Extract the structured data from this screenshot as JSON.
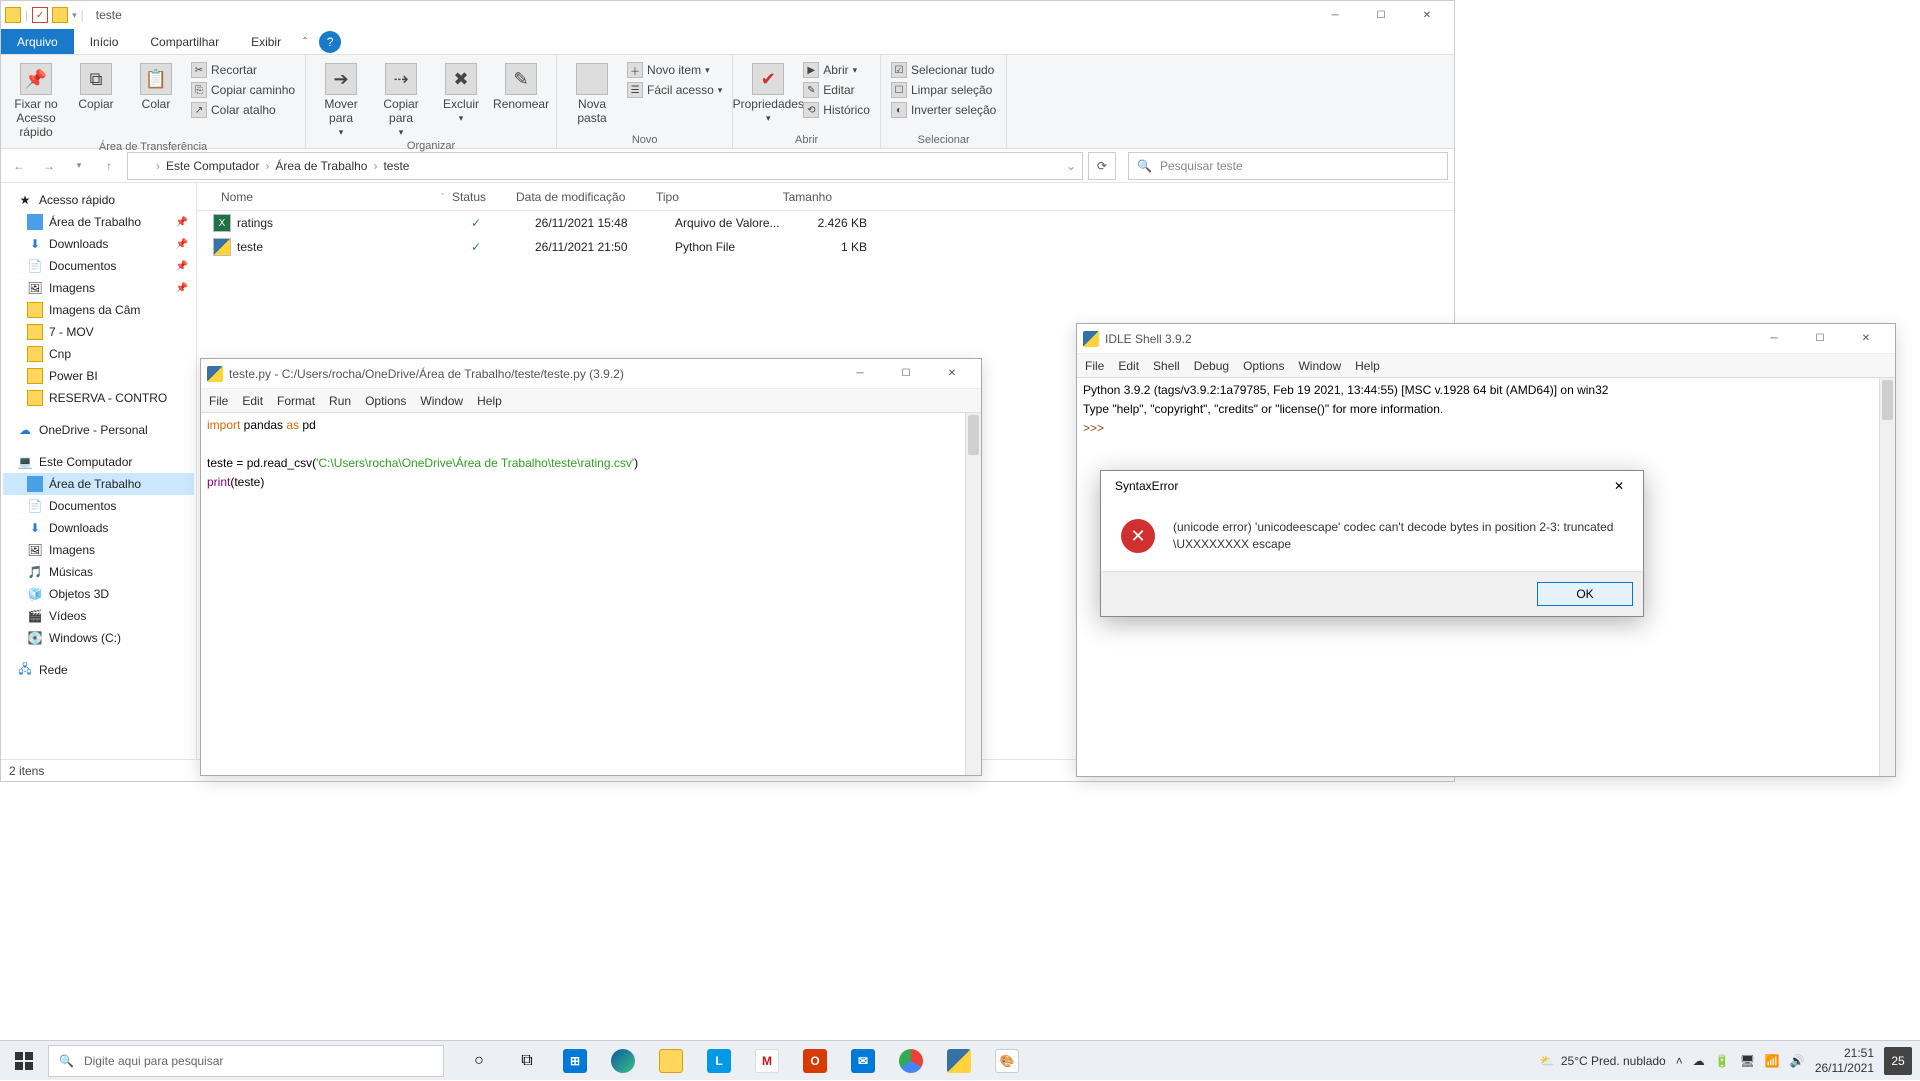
{
  "explorer": {
    "title": "teste",
    "tabs": {
      "file": "Arquivo",
      "home": "Início",
      "share": "Compartilhar",
      "view": "Exibir"
    },
    "ribbon": {
      "pin": "Fixar no Acesso rápido",
      "copy": "Copiar",
      "paste": "Colar",
      "cut": "Recortar",
      "copypath": "Copiar caminho",
      "pasteshortcut": "Colar atalho",
      "clipboard": "Área de Transferência",
      "moveto": "Mover para",
      "copyto": "Copiar para",
      "delete": "Excluir",
      "rename": "Renomear",
      "organize": "Organizar",
      "newfolder": "Nova pasta",
      "newitem": "Novo item",
      "easyaccess": "Fácil acesso",
      "new": "Novo",
      "properties": "Propriedades",
      "open": "Abrir",
      "edit": "Editar",
      "history": "Histórico",
      "opengrp": "Abrir",
      "selectall": "Selecionar tudo",
      "selectnone": "Limpar seleção",
      "invert": "Inverter seleção",
      "select": "Selecionar"
    },
    "breadcrumb": [
      "Este Computador",
      "Área de Trabalho",
      "teste"
    ],
    "search_placeholder": "Pesquisar teste",
    "columns": {
      "name": "Nome",
      "status": "Status",
      "modified": "Data de modificação",
      "type": "Tipo",
      "size": "Tamanho"
    },
    "rows": [
      {
        "name": "ratings",
        "status": "✓",
        "modified": "26/11/2021 15:48",
        "type": "Arquivo de Valore...",
        "size": "2.426 KB"
      },
      {
        "name": "teste",
        "status": "✓",
        "modified": "26/11/2021 21:50",
        "type": "Python File",
        "size": "1 KB"
      }
    ],
    "tree": {
      "quick": "Acesso rápido",
      "quick_items": [
        "Área de Trabalho",
        "Downloads",
        "Documentos",
        "Imagens",
        "Imagens da Câm",
        "7 - MOV",
        "Cnp",
        "Power BI",
        "RESERVA - CONTRO"
      ],
      "onedrive": "OneDrive - Personal",
      "thispc": "Este Computador",
      "pc_items": [
        "Área de Trabalho",
        "Documentos",
        "Downloads",
        "Imagens",
        "Músicas",
        "Objetos 3D",
        "Vídeos",
        "Windows (C:)"
      ],
      "network": "Rede"
    },
    "status": "2 itens"
  },
  "editor": {
    "title": "teste.py - C:/Users/rocha/OneDrive/Área de Trabalho/teste/teste.py (3.9.2)",
    "menu": [
      "File",
      "Edit",
      "Format",
      "Run",
      "Options",
      "Window",
      "Help"
    ],
    "code_import": "import",
    "code_pandas": " pandas ",
    "code_as": "as",
    "code_pd": " pd",
    "code_line2a": "teste = pd.read_csv(",
    "code_str": "'C:\\Users\\rocha\\OneDrive\\Área de Trabalho\\teste\\rating.csv'",
    "code_line2b": ")",
    "code_print": "print",
    "code_print_arg": "(teste)"
  },
  "shell": {
    "title": "IDLE Shell 3.9.2",
    "menu": [
      "File",
      "Edit",
      "Shell",
      "Debug",
      "Options",
      "Window",
      "Help"
    ],
    "text": "Python 3.9.2 (tags/v3.9.2:1a79785, Feb 19 2021, 13:44:55) [MSC v.1928 64 bit (AMD64)] on win32\nType \"help\", \"copyright\", \"credits\" or \"license()\" for more information.",
    "prompt": ">>> "
  },
  "dialog": {
    "title": "SyntaxError",
    "message": "(unicode error) 'unicodeescape' codec can't decode bytes in position 2-3: truncated \\UXXXXXXXX escape",
    "ok": "OK"
  },
  "taskbar": {
    "search_placeholder": "Digite aqui para pesquisar",
    "weather": "25°C  Pred. nublado",
    "time": "21:51",
    "date": "26/11/2021",
    "notif_count": "25"
  }
}
